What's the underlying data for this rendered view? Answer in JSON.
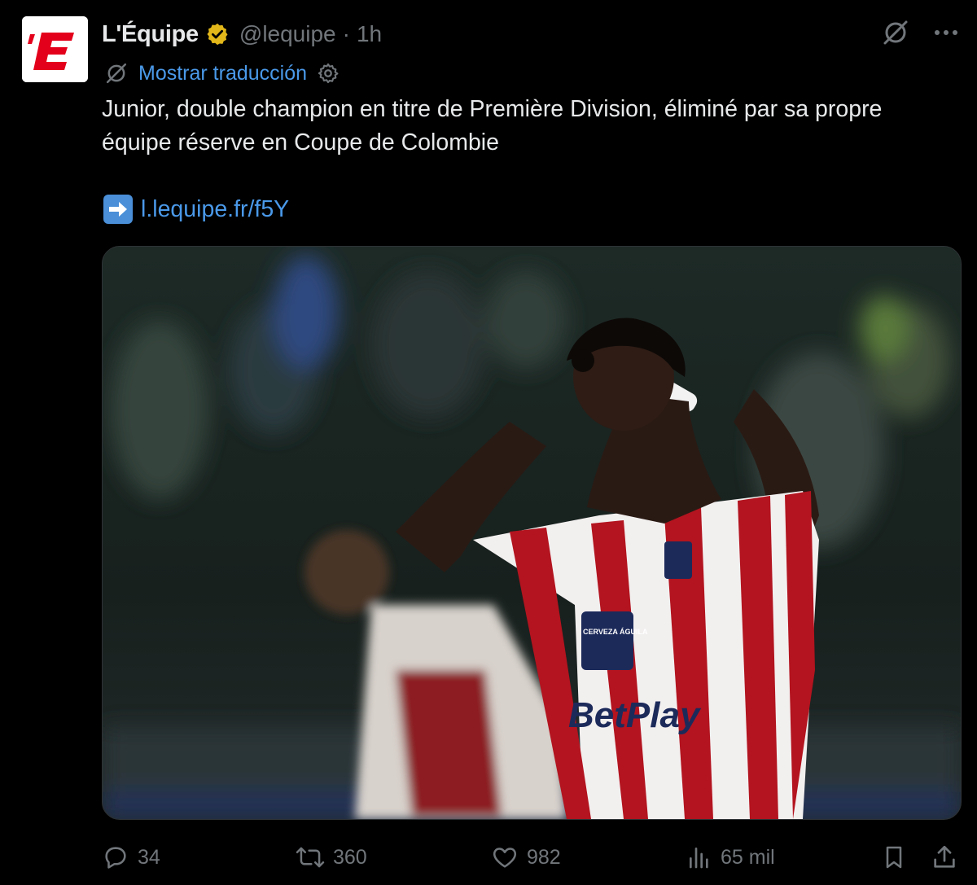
{
  "tweet": {
    "display_name": "L'Équipe",
    "handle": "@lequipe",
    "separator": "·",
    "time": "1h",
    "translate_label": "Mostrar traducción",
    "text_line1": "Junior, double champion en titre de Première Division, éliminé par sa propre",
    "text_line2": "équipe réserve en Coupe de Colombie",
    "link_text": "l.lequipe.fr/f5Y",
    "avatar_logo_text": "'E",
    "image_jersey_text": "BetPlay",
    "image_sponsor_text": "CERVEZA ÁGUILA"
  },
  "actions": {
    "replies": "34",
    "retweets": "360",
    "likes": "982",
    "views": "65 mil"
  },
  "colors": {
    "background": "#000000",
    "text": "#e7e9ea",
    "muted": "#71767b",
    "link": "#4a99e9",
    "verified_gold": "#e2b719",
    "brand_red": "#e3001b"
  },
  "icons": {
    "verified": "verified-badge-icon",
    "grok": "grok-icon",
    "more": "more-icon",
    "translate": "translate-icon",
    "settings": "gear-icon",
    "arrow": "arrow-right-emoji-icon",
    "reply": "reply-icon",
    "retweet": "retweet-icon",
    "like": "heart-icon",
    "views": "views-chart-icon",
    "bookmark": "bookmark-icon",
    "share": "share-icon"
  }
}
